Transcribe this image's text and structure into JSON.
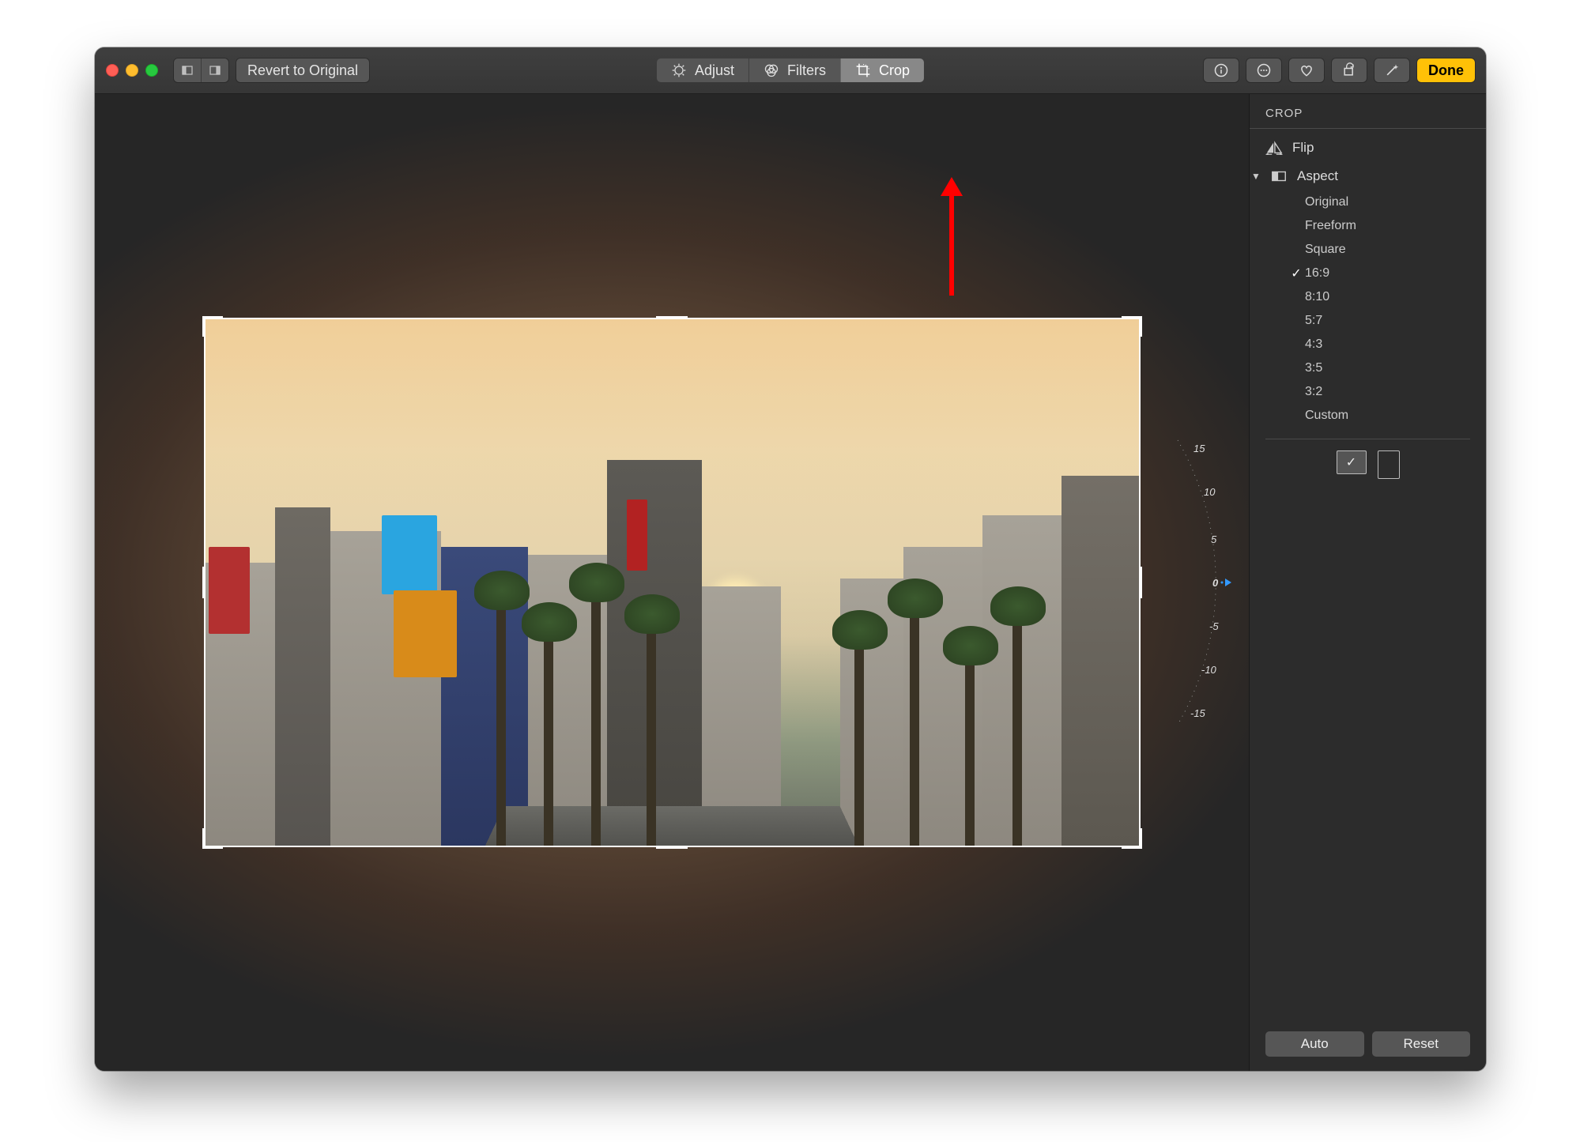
{
  "toolbar": {
    "revert_label": "Revert to Original",
    "tabs": {
      "adjust": "Adjust",
      "filters": "Filters",
      "crop": "Crop"
    },
    "done_label": "Done",
    "active_tab": "crop"
  },
  "sidebar": {
    "title": "CROP",
    "flip_label": "Flip",
    "aspect_label": "Aspect",
    "aspect_options": [
      "Original",
      "Freeform",
      "Square",
      "16:9",
      "8:10",
      "5:7",
      "4:3",
      "3:5",
      "3:2",
      "Custom"
    ],
    "aspect_selected": "16:9",
    "footer": {
      "auto": "Auto",
      "reset": "Reset"
    }
  },
  "dial": {
    "ticks": [
      "15",
      "10",
      "5",
      "0",
      "-5",
      "-10",
      "-15"
    ],
    "value": "0"
  },
  "annotation": {
    "arrow_color": "#ff0000"
  }
}
